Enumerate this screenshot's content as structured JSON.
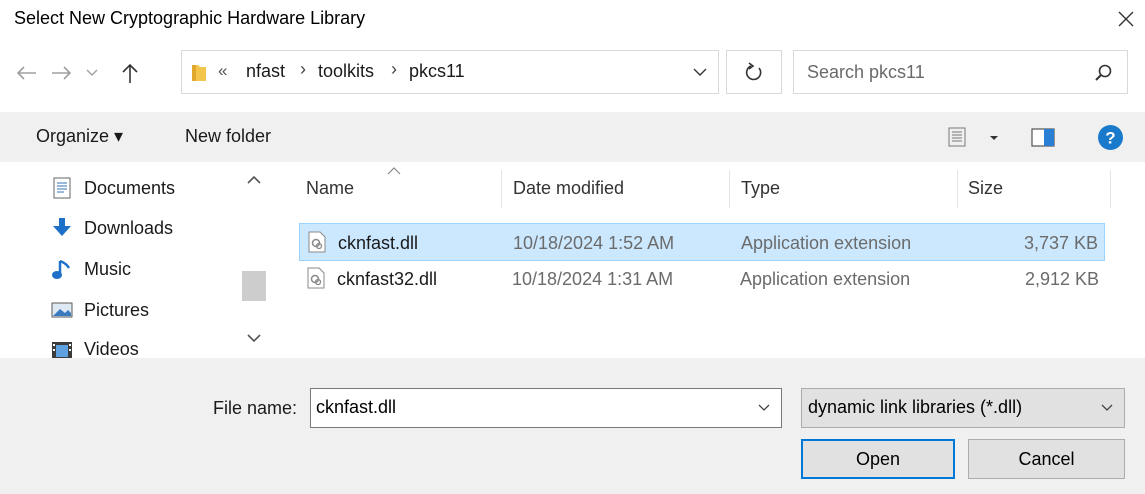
{
  "window": {
    "title": "Select New Cryptographic Hardware Library"
  },
  "address": {
    "overflow": "«",
    "crumbs": [
      "nfast",
      "toolkits",
      "pkcs11"
    ]
  },
  "search": {
    "placeholder": "Search pkcs11"
  },
  "toolbar": {
    "organize": "Organize ▾",
    "new_folder": "New folder"
  },
  "nav": {
    "items": [
      {
        "label": "Documents",
        "icon": "documents-icon"
      },
      {
        "label": "Downloads",
        "icon": "downloads-icon"
      },
      {
        "label": "Music",
        "icon": "music-icon"
      },
      {
        "label": "Pictures",
        "icon": "pictures-icon"
      },
      {
        "label": "Videos",
        "icon": "videos-icon"
      }
    ]
  },
  "columns": {
    "name": "Name",
    "date": "Date modified",
    "type": "Type",
    "size": "Size"
  },
  "files": [
    {
      "name": "cknfast.dll",
      "date": "10/18/2024 1:52 AM",
      "type": "Application extension",
      "size": "3,737 KB",
      "selected": true
    },
    {
      "name": "cknfast32.dll",
      "date": "10/18/2024 1:31 AM",
      "type": "Application extension",
      "size": "2,912 KB",
      "selected": false
    }
  ],
  "bottom": {
    "file_name_label": "File name:",
    "file_name_value": "cknfast.dll",
    "filter": "dynamic link libraries (*.dll)",
    "open": "Open",
    "cancel": "Cancel"
  },
  "colors": {
    "selection": "#cce8ff",
    "selection_border": "#99d1ff",
    "accent": "#0078d7",
    "help": "#1979ca",
    "toolbar_bg": "#f0f0f0"
  }
}
